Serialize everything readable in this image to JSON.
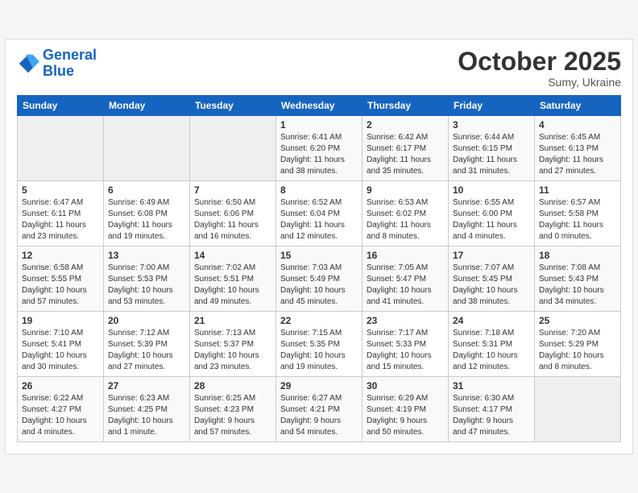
{
  "logo": {
    "line1": "General",
    "line2": "Blue"
  },
  "title": "October 2025",
  "location": "Sumy, Ukraine",
  "days_of_week": [
    "Sunday",
    "Monday",
    "Tuesday",
    "Wednesday",
    "Thursday",
    "Friday",
    "Saturday"
  ],
  "weeks": [
    [
      {
        "day": "",
        "info": ""
      },
      {
        "day": "",
        "info": ""
      },
      {
        "day": "",
        "info": ""
      },
      {
        "day": "1",
        "info": "Sunrise: 6:41 AM\nSunset: 6:20 PM\nDaylight: 11 hours\nand 38 minutes."
      },
      {
        "day": "2",
        "info": "Sunrise: 6:42 AM\nSunset: 6:17 PM\nDaylight: 11 hours\nand 35 minutes."
      },
      {
        "day": "3",
        "info": "Sunrise: 6:44 AM\nSunset: 6:15 PM\nDaylight: 11 hours\nand 31 minutes."
      },
      {
        "day": "4",
        "info": "Sunrise: 6:45 AM\nSunset: 6:13 PM\nDaylight: 11 hours\nand 27 minutes."
      }
    ],
    [
      {
        "day": "5",
        "info": "Sunrise: 6:47 AM\nSunset: 6:11 PM\nDaylight: 11 hours\nand 23 minutes."
      },
      {
        "day": "6",
        "info": "Sunrise: 6:49 AM\nSunset: 6:08 PM\nDaylight: 11 hours\nand 19 minutes."
      },
      {
        "day": "7",
        "info": "Sunrise: 6:50 AM\nSunset: 6:06 PM\nDaylight: 11 hours\nand 16 minutes."
      },
      {
        "day": "8",
        "info": "Sunrise: 6:52 AM\nSunset: 6:04 PM\nDaylight: 11 hours\nand 12 minutes."
      },
      {
        "day": "9",
        "info": "Sunrise: 6:53 AM\nSunset: 6:02 PM\nDaylight: 11 hours\nand 8 minutes."
      },
      {
        "day": "10",
        "info": "Sunrise: 6:55 AM\nSunset: 6:00 PM\nDaylight: 11 hours\nand 4 minutes."
      },
      {
        "day": "11",
        "info": "Sunrise: 6:57 AM\nSunset: 5:58 PM\nDaylight: 11 hours\nand 0 minutes."
      }
    ],
    [
      {
        "day": "12",
        "info": "Sunrise: 6:58 AM\nSunset: 5:55 PM\nDaylight: 10 hours\nand 57 minutes."
      },
      {
        "day": "13",
        "info": "Sunrise: 7:00 AM\nSunset: 5:53 PM\nDaylight: 10 hours\nand 53 minutes."
      },
      {
        "day": "14",
        "info": "Sunrise: 7:02 AM\nSunset: 5:51 PM\nDaylight: 10 hours\nand 49 minutes."
      },
      {
        "day": "15",
        "info": "Sunrise: 7:03 AM\nSunset: 5:49 PM\nDaylight: 10 hours\nand 45 minutes."
      },
      {
        "day": "16",
        "info": "Sunrise: 7:05 AM\nSunset: 5:47 PM\nDaylight: 10 hours\nand 41 minutes."
      },
      {
        "day": "17",
        "info": "Sunrise: 7:07 AM\nSunset: 5:45 PM\nDaylight: 10 hours\nand 38 minutes."
      },
      {
        "day": "18",
        "info": "Sunrise: 7:08 AM\nSunset: 5:43 PM\nDaylight: 10 hours\nand 34 minutes."
      }
    ],
    [
      {
        "day": "19",
        "info": "Sunrise: 7:10 AM\nSunset: 5:41 PM\nDaylight: 10 hours\nand 30 minutes."
      },
      {
        "day": "20",
        "info": "Sunrise: 7:12 AM\nSunset: 5:39 PM\nDaylight: 10 hours\nand 27 minutes."
      },
      {
        "day": "21",
        "info": "Sunrise: 7:13 AM\nSunset: 5:37 PM\nDaylight: 10 hours\nand 23 minutes."
      },
      {
        "day": "22",
        "info": "Sunrise: 7:15 AM\nSunset: 5:35 PM\nDaylight: 10 hours\nand 19 minutes."
      },
      {
        "day": "23",
        "info": "Sunrise: 7:17 AM\nSunset: 5:33 PM\nDaylight: 10 hours\nand 15 minutes."
      },
      {
        "day": "24",
        "info": "Sunrise: 7:18 AM\nSunset: 5:31 PM\nDaylight: 10 hours\nand 12 minutes."
      },
      {
        "day": "25",
        "info": "Sunrise: 7:20 AM\nSunset: 5:29 PM\nDaylight: 10 hours\nand 8 minutes."
      }
    ],
    [
      {
        "day": "26",
        "info": "Sunrise: 6:22 AM\nSunset: 4:27 PM\nDaylight: 10 hours\nand 4 minutes."
      },
      {
        "day": "27",
        "info": "Sunrise: 6:23 AM\nSunset: 4:25 PM\nDaylight: 10 hours\nand 1 minute."
      },
      {
        "day": "28",
        "info": "Sunrise: 6:25 AM\nSunset: 4:23 PM\nDaylight: 9 hours\nand 57 minutes."
      },
      {
        "day": "29",
        "info": "Sunrise: 6:27 AM\nSunset: 4:21 PM\nDaylight: 9 hours\nand 54 minutes."
      },
      {
        "day": "30",
        "info": "Sunrise: 6:29 AM\nSunset: 4:19 PM\nDaylight: 9 hours\nand 50 minutes."
      },
      {
        "day": "31",
        "info": "Sunrise: 6:30 AM\nSunset: 4:17 PM\nDaylight: 9 hours\nand 47 minutes."
      },
      {
        "day": "",
        "info": ""
      }
    ]
  ]
}
